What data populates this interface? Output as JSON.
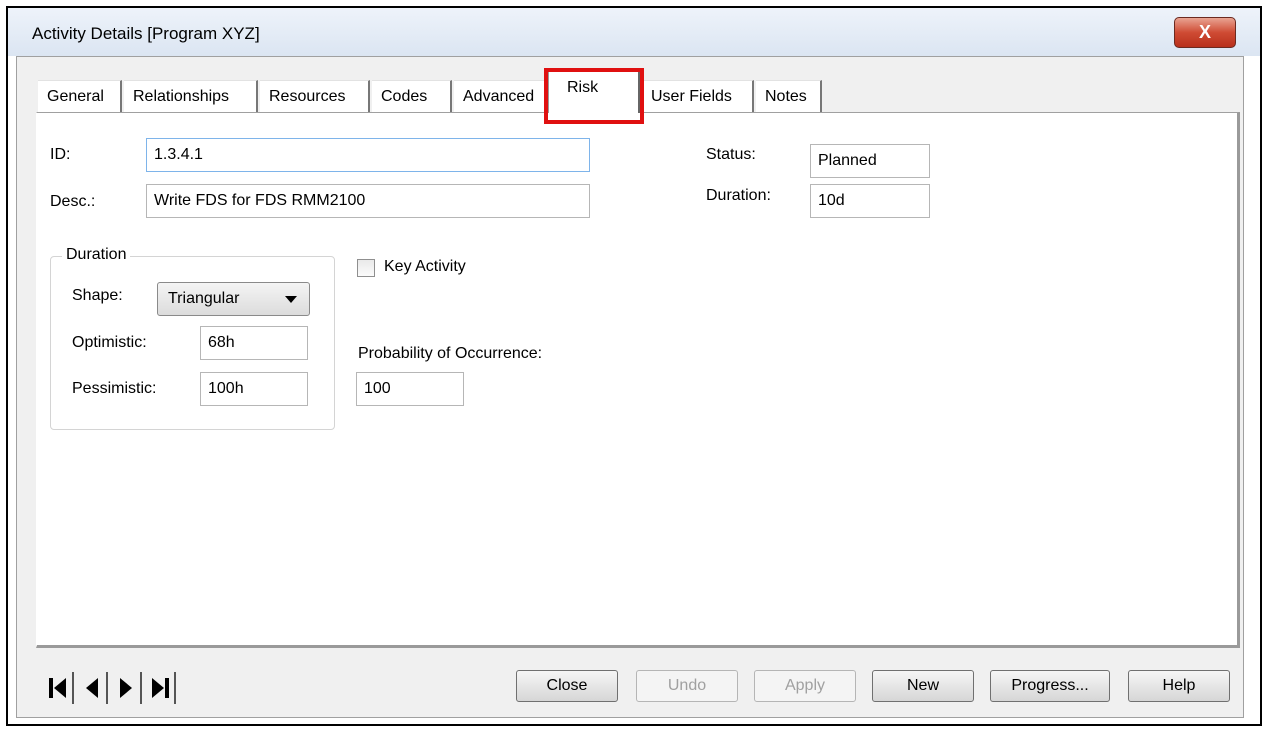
{
  "window": {
    "title": "Activity Details [Program XYZ]",
    "close_glyph": "X"
  },
  "tabs": [
    {
      "label": "General"
    },
    {
      "label": "Relationships"
    },
    {
      "label": "Resources"
    },
    {
      "label": "Codes"
    },
    {
      "label": "Advanced"
    },
    {
      "label": "Risk",
      "active": true
    },
    {
      "label": "User Fields"
    },
    {
      "label": "Notes"
    }
  ],
  "highlight_color": "#e01010",
  "form": {
    "id_label": "ID:",
    "id_value": "1.3.4.1",
    "desc_label": "Desc.:",
    "desc_value": "Write FDS for FDS RMM2100",
    "status_label": "Status:",
    "status_value": "Planned",
    "duration_label": "Duration:",
    "duration_value": "10d"
  },
  "duration_group": {
    "legend": "Duration",
    "shape_label": "Shape:",
    "shape_value": "Triangular",
    "optimistic_label": "Optimistic:",
    "optimistic_value": "68h",
    "pessimistic_label": "Pessimistic:",
    "pessimistic_value": "100h"
  },
  "key_activity": {
    "label": "Key Activity",
    "checked": false
  },
  "probability": {
    "label": "Probability of Occurrence:",
    "value": "100"
  },
  "nav_buttons": [
    {
      "icon": "first-record-icon"
    },
    {
      "icon": "previous-record-icon"
    },
    {
      "icon": "next-record-icon"
    },
    {
      "icon": "last-record-icon"
    }
  ],
  "buttons": {
    "close": "Close",
    "undo": "Undo",
    "apply": "Apply",
    "new": "New",
    "progress": "Progress...",
    "help": "Help"
  }
}
